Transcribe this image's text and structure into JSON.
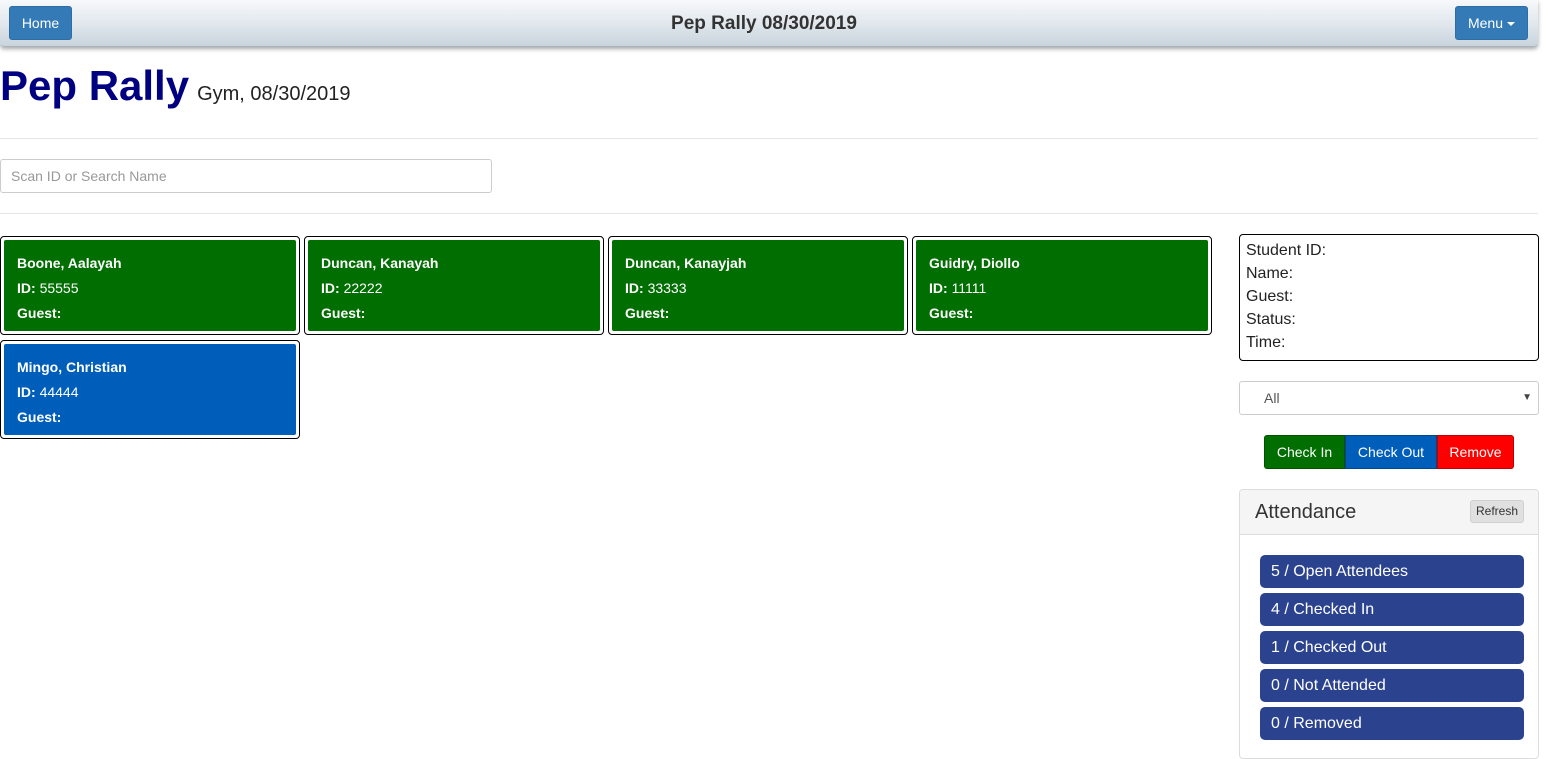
{
  "navbar": {
    "home_label": "Home",
    "title": "Pep Rally 08/30/2019",
    "menu_label": "Menu"
  },
  "page": {
    "title": "Pep Rally",
    "subtitle": "Gym, 08/30/2019"
  },
  "search": {
    "placeholder": "Scan ID or Search Name",
    "value": ""
  },
  "labels": {
    "id": "ID:",
    "guest": "Guest:"
  },
  "attendees": [
    {
      "name": "Boone, Aalayah",
      "id": "55555",
      "guest": "",
      "status": "checked-in",
      "color": "#006e00"
    },
    {
      "name": "Duncan, Kanayah",
      "id": "22222",
      "guest": "",
      "status": "checked-in",
      "color": "#006e00"
    },
    {
      "name": "Duncan, Kanayjah",
      "id": "33333",
      "guest": "",
      "status": "checked-in",
      "color": "#006e00"
    },
    {
      "name": "Guidry, Diollo",
      "id": "11111",
      "guest": "",
      "status": "checked-in",
      "color": "#006e00"
    },
    {
      "name": "Mingo, Christian",
      "id": "44444",
      "guest": "",
      "status": "checked-out",
      "color": "#005ebb"
    }
  ],
  "details": {
    "student_id_label": "Student ID:",
    "name_label": "Name:",
    "guest_label": "Guest:",
    "status_label": "Status:",
    "time_label": "Time:"
  },
  "filter": {
    "selected": "All"
  },
  "actions": {
    "check_in": "Check In",
    "check_out": "Check Out",
    "remove": "Remove"
  },
  "attendance": {
    "title": "Attendance",
    "refresh_label": "Refresh",
    "stats": [
      "5 / Open Attendees",
      "4 / Checked In",
      "1 / Checked Out",
      "0 / Not Attended",
      "0 / Removed"
    ]
  },
  "colors": {
    "checked_in": "#006e00",
    "checked_out": "#005ebb",
    "remove": "#ff0000",
    "stat_badge": "#2b438f",
    "primary": "#337ab7",
    "title": "#000080"
  }
}
